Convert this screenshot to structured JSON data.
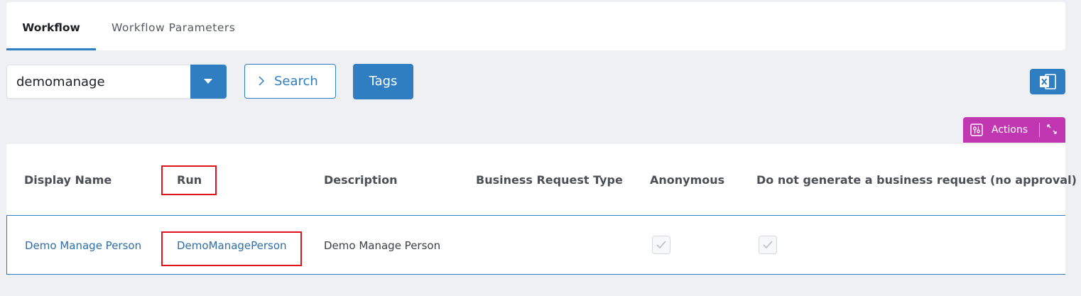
{
  "tabs": [
    {
      "label": "Workflow",
      "active": true
    },
    {
      "label": "Workflow Parameters",
      "active": false
    }
  ],
  "toolbar": {
    "combo_value": "demomanage",
    "search_label": "Search",
    "tags_label": "Tags",
    "actions_label": "Actions"
  },
  "table": {
    "columns": [
      "Display Name",
      "Run",
      "Description",
      "Business Request Type",
      "Anonymous",
      "Do not generate a business request (no approval)"
    ],
    "rows": [
      {
        "display_name": "Demo Manage Person",
        "run": "DemoManagePerson",
        "description": "Demo Manage Person",
        "business_request_type": "",
        "anonymous": true,
        "no_business_request": true
      }
    ]
  },
  "colors": {
    "accent": "#2e7ec1",
    "actions": "#c037b1",
    "highlight": "#e0141e",
    "background": "#eef0f4"
  },
  "icons": [
    "chevron-down-icon",
    "chevron-right-icon",
    "excel-icon",
    "sliders-icon",
    "expand-icon",
    "check-icon"
  ]
}
